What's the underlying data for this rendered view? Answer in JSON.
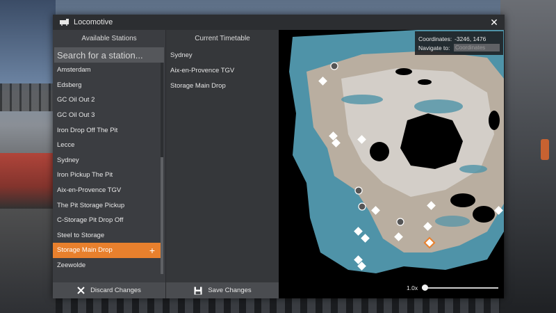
{
  "window": {
    "title": "Locomotive",
    "close_glyph": "✕"
  },
  "stations_panel": {
    "header": "Available Stations",
    "search_placeholder": "Search for a station...",
    "items": [
      {
        "label": "Amsterdam"
      },
      {
        "label": "Edsberg"
      },
      {
        "label": "GC Oil Out 2"
      },
      {
        "label": "GC Oil Out 3"
      },
      {
        "label": "Iron Drop Off The Pit"
      },
      {
        "label": "Lecce"
      },
      {
        "label": "Sydney"
      },
      {
        "label": "Iron Pickup The Pit"
      },
      {
        "label": "Aix-en-Provence TGV"
      },
      {
        "label": "The Pit Storage Pickup"
      },
      {
        "label": "C-Storage Pit Drop Off"
      },
      {
        "label": "Steel to Storage"
      },
      {
        "label": "Storage Main Drop",
        "selected": true
      },
      {
        "label": "Zeewolde"
      }
    ],
    "add_glyph": "+"
  },
  "timetable_panel": {
    "header": "Current Timetable",
    "items": [
      "Sydney",
      "Aix-en-Provence TGV",
      "Storage Main Drop"
    ]
  },
  "footer": {
    "discard_label": "Discard Changes",
    "save_label": "Save Changes"
  },
  "map": {
    "coordinates_label": "Coordinates:",
    "coordinates_value": "-3246, 1476",
    "navigate_label": "Navigate to:",
    "navigate_placeholder": "Coordinates",
    "zoom_label": "1.0x",
    "zoom_level": 0
  },
  "colors": {
    "accent": "#e8802d",
    "water": "#4f93a8",
    "land": "#b9aea0",
    "land_light": "#d6d2cc",
    "void": "#000000"
  },
  "icons": [
    "train-icon",
    "close-icon",
    "search-icon",
    "plus-icon",
    "x-icon",
    "save-icon",
    "station-marker-icon"
  ]
}
